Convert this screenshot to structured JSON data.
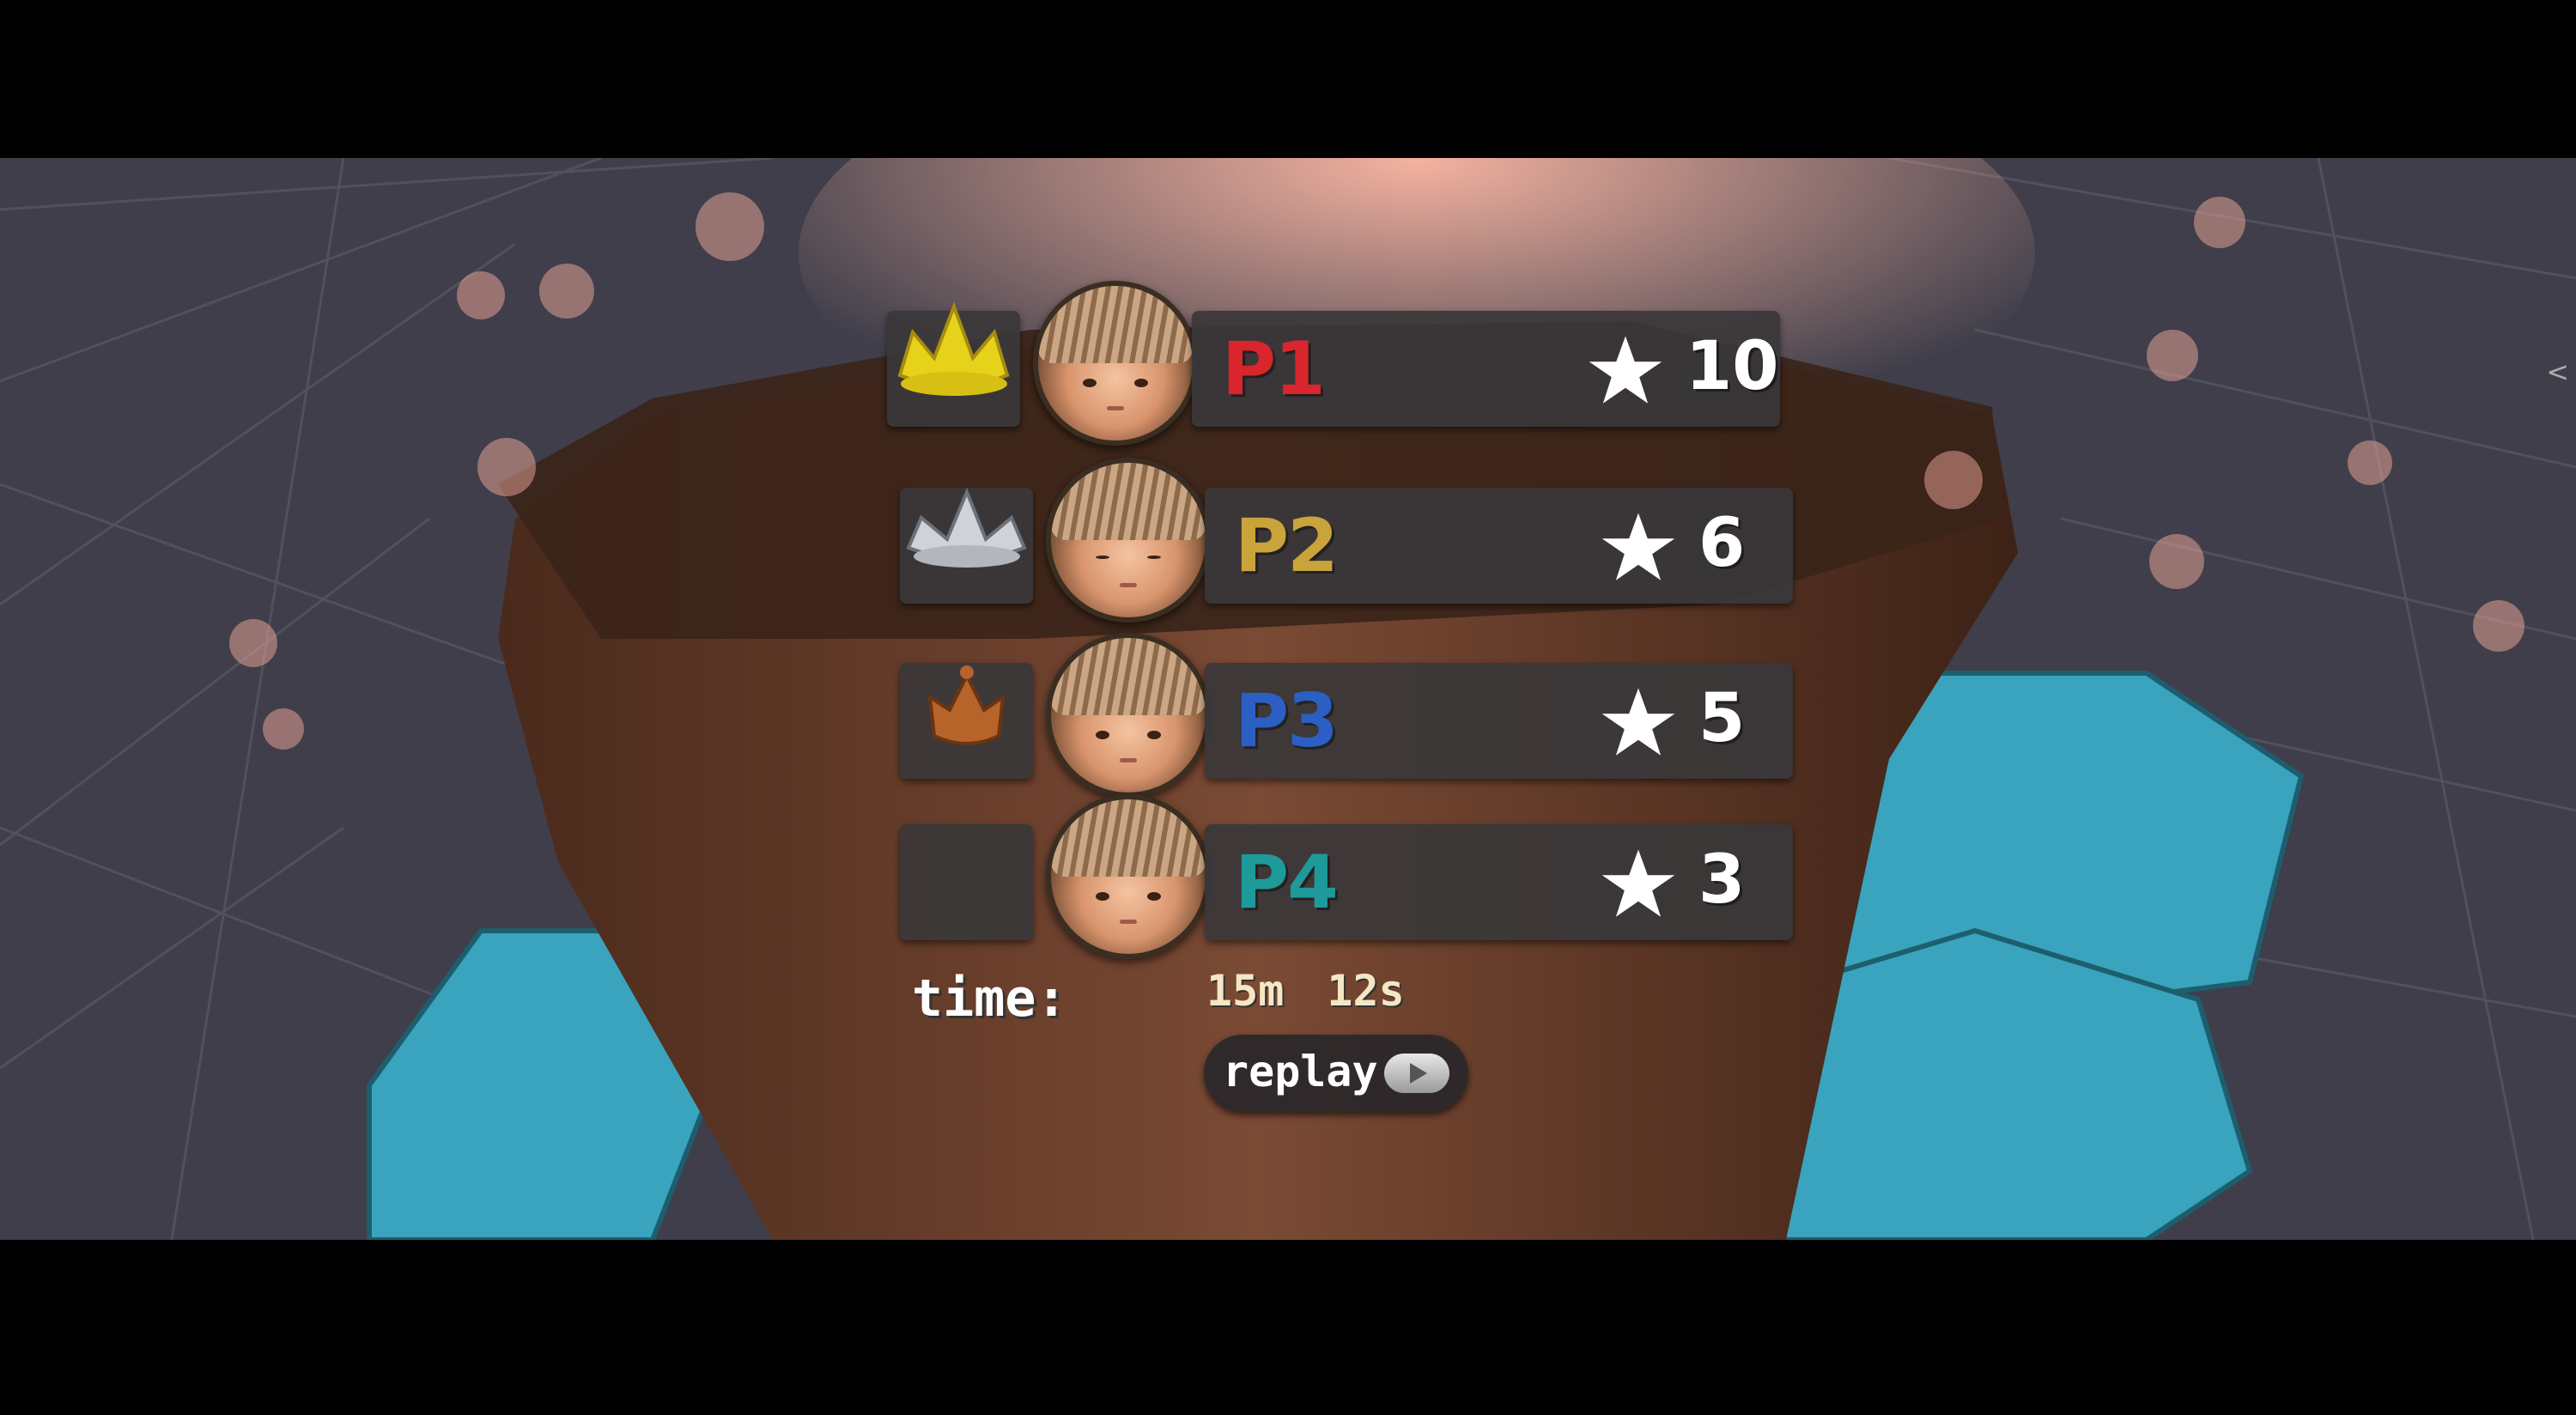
{
  "scoreboard": {
    "players": [
      {
        "rank_icon": "gold-crown-icon",
        "name": "P1",
        "name_color": "#d8262c",
        "score": "10"
      },
      {
        "rank_icon": "silver-crown-icon",
        "name": "P2",
        "name_color": "#c9a43a",
        "score": "6"
      },
      {
        "rank_icon": "bronze-crown-icon",
        "name": "P3",
        "name_color": "#2c5fc4",
        "score": "5"
      },
      {
        "rank_icon": "",
        "name": "P4",
        "name_color": "#1f9a9a",
        "score": "3"
      }
    ]
  },
  "time": {
    "label": "time:",
    "value": "15m 12s"
  },
  "replay": {
    "label": "replay"
  },
  "side_glyph": "<"
}
